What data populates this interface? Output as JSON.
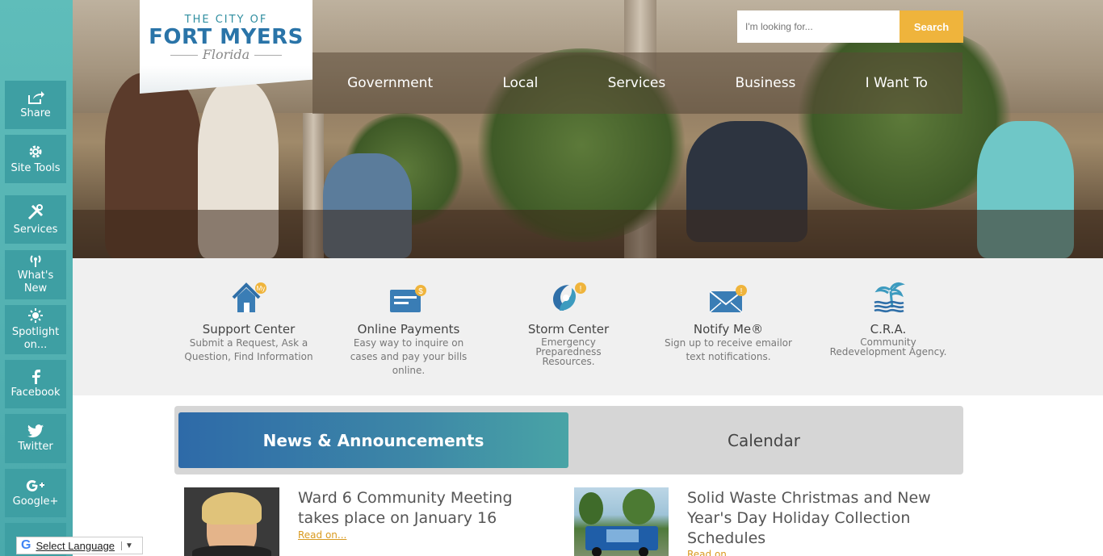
{
  "sidebar": {
    "items": [
      {
        "label": "Share",
        "icon": "share-icon"
      },
      {
        "label": "Site Tools",
        "icon": "gear-icon"
      },
      {
        "label": "Services",
        "icon": "tools-icon"
      },
      {
        "label": "What's New",
        "icon": "broadcast-icon"
      },
      {
        "label": "Spotlight on...",
        "icon": "sun-icon"
      },
      {
        "label": "Facebook",
        "icon": "facebook-icon"
      },
      {
        "label": "Twitter",
        "icon": "twitter-icon"
      },
      {
        "label": "Google+",
        "icon": "google-plus-icon"
      }
    ]
  },
  "logo": {
    "line1": "THE CITY OF",
    "line2": "FORT MYERS",
    "line3": "Florida"
  },
  "search": {
    "placeholder": "I'm looking for...",
    "button": "Search"
  },
  "nav": [
    "Government",
    "Local",
    "Services",
    "Business",
    "I Want To"
  ],
  "quick_links": [
    {
      "title": "Support Center",
      "desc": "Submit a Request, Ask a Question, Find Information",
      "icon": "house-icon"
    },
    {
      "title": "Online Payments",
      "desc": "Easy way to inquire on cases and pay your bills online.",
      "icon": "payment-card-icon"
    },
    {
      "title": "Storm Center",
      "desc": "Emergency Preparedness Resources.",
      "icon": "hurricane-icon"
    },
    {
      "title": "Notify Me®",
      "desc": "Sign up to receive emailor text notifications.",
      "icon": "envelope-icon"
    },
    {
      "title": "C.R.A.",
      "desc": "Community Redevelopment Agency.",
      "icon": "palm-tree-icon"
    }
  ],
  "tabs": {
    "news": "News & Announcements",
    "calendar": "Calendar"
  },
  "news": [
    {
      "title": "Ward 6 Community Meeting takes place on January 16",
      "link": "Read on..."
    },
    {
      "title": "Solid Waste Christmas and New Year's Day Holiday Collection Schedules",
      "link": "Read on..."
    }
  ],
  "translate": {
    "label": "Select Language"
  },
  "colors": {
    "teal": "#4aa9ac",
    "brand_blue": "#2a74a8",
    "accent_gold": "#efb43c"
  }
}
